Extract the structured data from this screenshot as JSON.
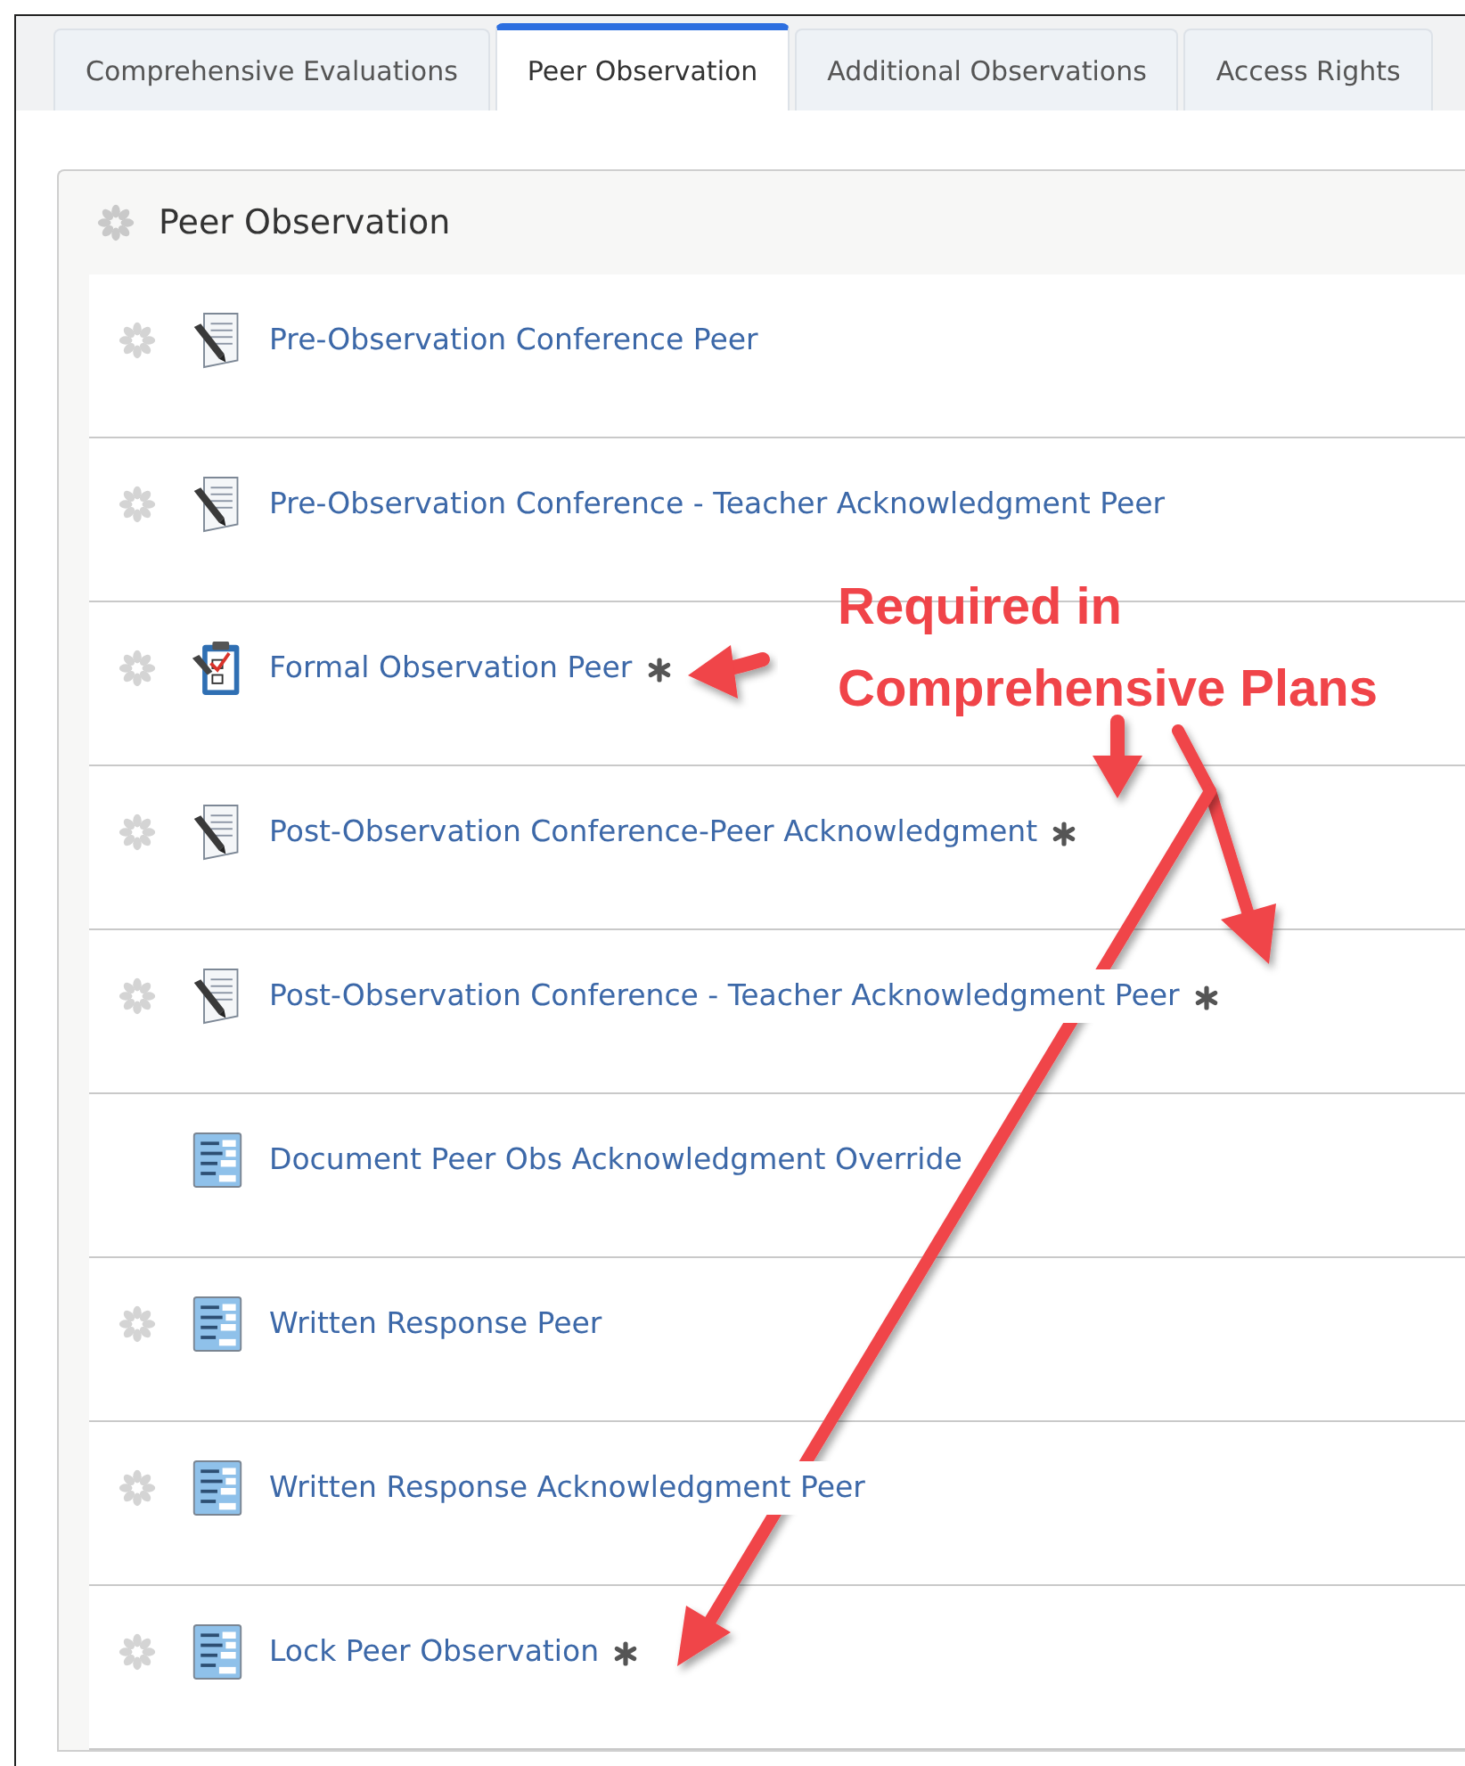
{
  "tabs": [
    {
      "label": "Comprehensive Evaluations",
      "selected": false
    },
    {
      "label": "Peer Observation",
      "selected": true
    },
    {
      "label": "Additional Observations",
      "selected": false
    },
    {
      "label": "Access Rights",
      "selected": false
    }
  ],
  "panel": {
    "title": "Peer Observation",
    "items": [
      {
        "label": "Pre-Observation Conference Peer",
        "draggable": true,
        "kind": "pen",
        "required": false
      },
      {
        "label": "Pre-Observation Conference - Teacher Acknowledgment Peer",
        "draggable": true,
        "kind": "pen",
        "required": false
      },
      {
        "label": "Formal Observation Peer",
        "draggable": true,
        "kind": "clipboard",
        "required": true
      },
      {
        "label": "Post-Observation Conference-Peer Acknowledgment",
        "draggable": true,
        "kind": "pen",
        "required": true
      },
      {
        "label": "Post-Observation Conference - Teacher Acknowledgment Peer",
        "draggable": true,
        "kind": "pen",
        "required": true
      },
      {
        "label": "Document Peer Obs Acknowledgment Override",
        "draggable": false,
        "kind": "form",
        "required": false
      },
      {
        "label": "Written Response Peer",
        "draggable": true,
        "kind": "form",
        "required": false
      },
      {
        "label": "Written Response Acknowledgment Peer",
        "draggable": true,
        "kind": "form",
        "required": false
      },
      {
        "label": "Lock Peer Observation",
        "draggable": true,
        "kind": "form",
        "required": true
      }
    ]
  },
  "annotation": {
    "text": "Required in Comprehensive Plans"
  }
}
